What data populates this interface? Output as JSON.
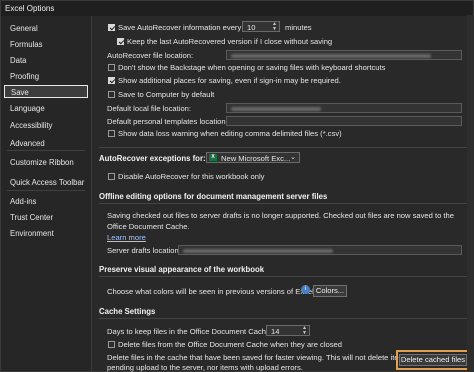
{
  "window": {
    "title": "Excel Options"
  },
  "sidebar": {
    "items": [
      {
        "label": "General"
      },
      {
        "label": "Formulas"
      },
      {
        "label": "Data"
      },
      {
        "label": "Proofing"
      },
      {
        "label": "Save"
      },
      {
        "label": "Language"
      },
      {
        "label": "Accessibility"
      },
      {
        "label": "Advanced"
      },
      {
        "label": "Customize Ribbon"
      },
      {
        "label": "Quick Access Toolbar"
      },
      {
        "label": "Add-ins"
      },
      {
        "label": "Trust Center"
      },
      {
        "label": "Environment"
      }
    ],
    "selected": "Save"
  },
  "save": {
    "autorecover_label": "Save AutoRecover information every",
    "autorecover_minutes": "10",
    "minutes_label": "minutes",
    "keep_last_label": "Keep the last AutoRecovered version if I close without saving",
    "autorecover_location_label": "AutoRecover file location:",
    "dont_show_backstage_label": "Don't show the Backstage when opening or saving files with keyboard shortcuts",
    "show_additional_places_label": "Show additional places for saving, even if sign-in may be required.",
    "save_to_computer_label": "Save to Computer by default",
    "default_local_label": "Default local file location:",
    "default_templates_label": "Default personal templates location:",
    "data_loss_label": "Show data loss warning when editing comma delimited files (*.csv)"
  },
  "exceptions": {
    "label": "AutoRecover exceptions for:",
    "workbook": "New Microsoft Exc...",
    "disable_label": "Disable AutoRecover for this workbook only"
  },
  "offline": {
    "heading": "Offline editing options for document management server files",
    "description": "Saving checked out files to server drafts is no longer supported. Checked out files are now saved to the Office Document Cache.",
    "learn_more": "Learn more",
    "server_drafts_label": "Server drafts location:"
  },
  "preserve": {
    "heading": "Preserve visual appearance of the workbook",
    "colors_label": "Choose what colors will be seen in previous versions of Excel:",
    "colors_button": "Colors..."
  },
  "cache": {
    "heading": "Cache Settings",
    "days_label": "Days to keep files in the Office Document Cache:",
    "days_value": "14",
    "delete_closed_label": "Delete files from the Office Document Cache when they are closed",
    "delete_info_line1": "Delete files in the cache that have been saved for faster viewing. This will not delete items",
    "delete_info_line2": "pending upload to the server, nor items with upload errors.",
    "delete_button": "Delete cached files"
  },
  "checkbox_states": {
    "autorecover": true,
    "keep_last": true,
    "dont_show_backstage": false,
    "show_additional_places": true,
    "save_to_computer": false,
    "data_loss": false,
    "disable_autorecover": false,
    "delete_closed": false
  },
  "colors": {
    "highlight": "#e0a050",
    "excel_green": "#1d6f42",
    "link": "#9ec5ff"
  }
}
